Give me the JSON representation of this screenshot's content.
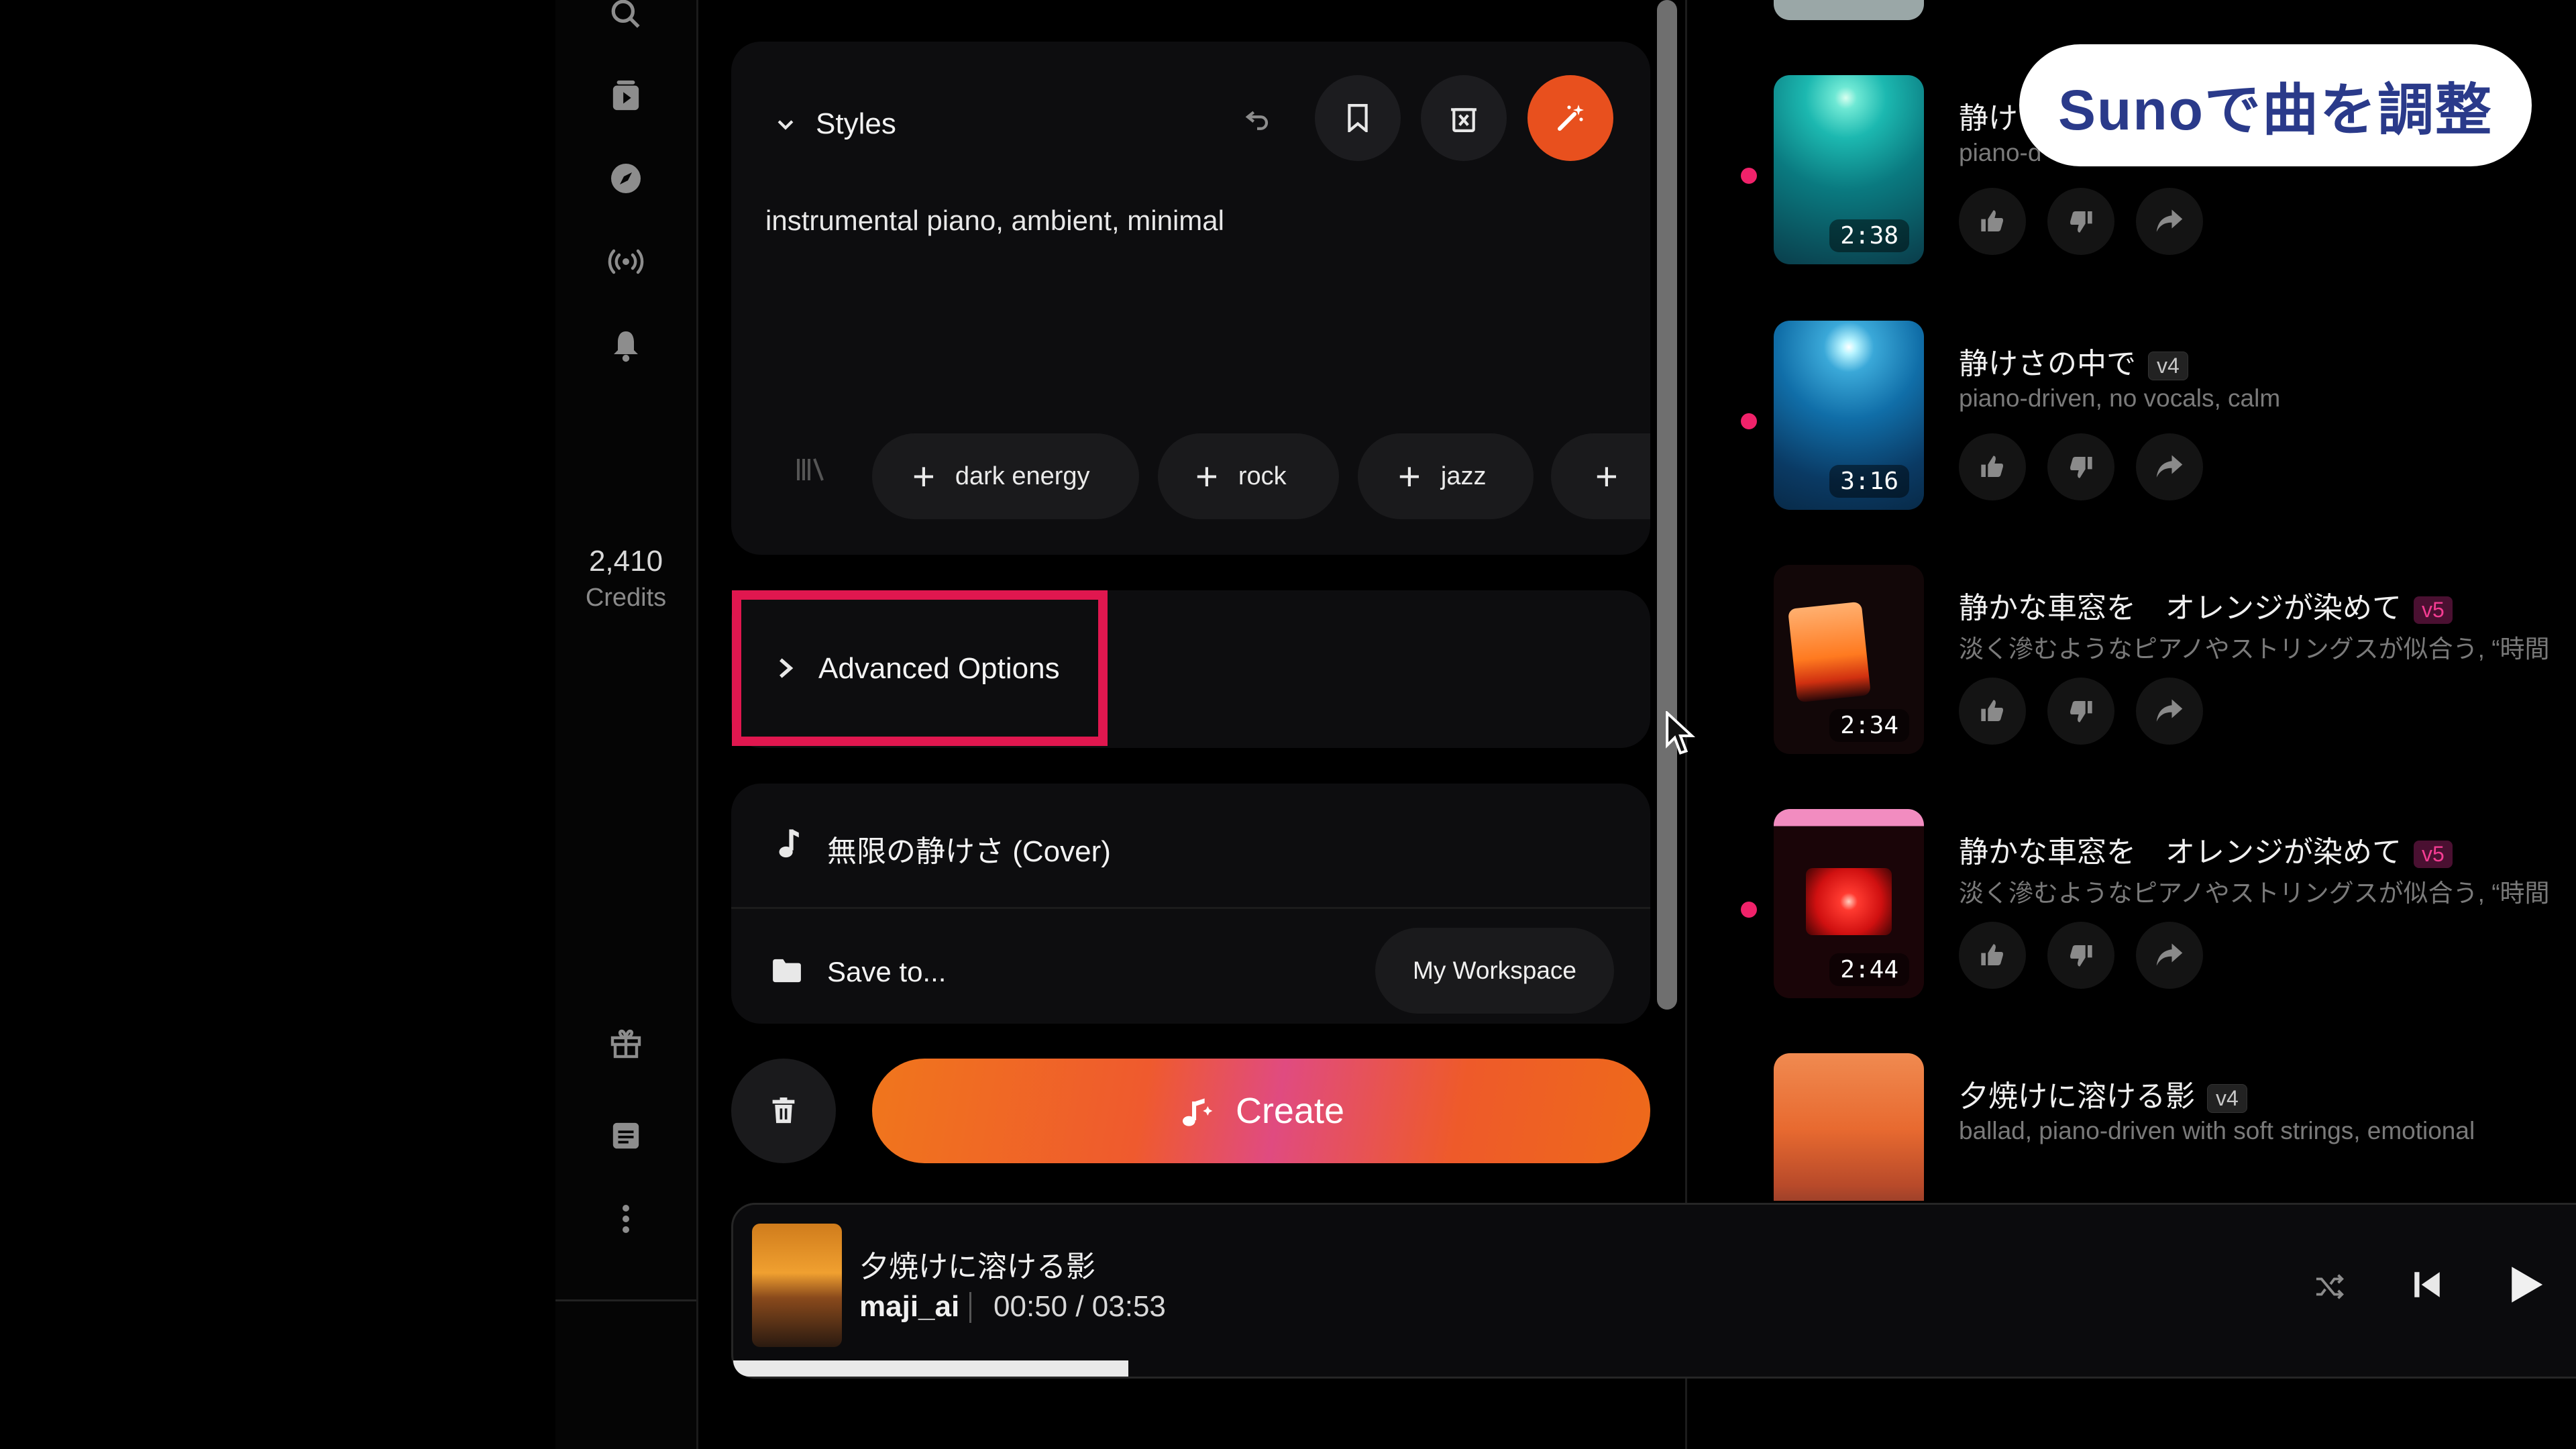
{
  "sidebar": {
    "icons": [
      "search-icon",
      "library-icon",
      "explore-icon",
      "radio-icon",
      "bell-icon",
      "gift-icon",
      "document-icon",
      "more-icon"
    ],
    "credits_value": "2,410",
    "credits_label": "Credits"
  },
  "styles": {
    "header": "Styles",
    "text": "instrumental piano, ambient, minimal",
    "chips": [
      "dark energy",
      "rock",
      "jazz"
    ],
    "magic_color": "#e8501e"
  },
  "advanced_options": {
    "label": "Advanced Options",
    "highlight_color": "#e0174f"
  },
  "song": {
    "title": "無限の静けさ (Cover)",
    "save_label": "Save to...",
    "workspace": "My Workspace"
  },
  "create": {
    "label": "Create"
  },
  "songs": [
    {
      "title": "静け",
      "version": "",
      "desc": "piano-d",
      "duration": "2:38",
      "unread": true
    },
    {
      "title": "静けさの中で",
      "version": "v4",
      "desc": "piano-driven, no vocals, calm",
      "duration": "3:16",
      "unread": true
    },
    {
      "title": "静かな車窓を　オレンジが染めて",
      "version": "v5",
      "desc": "淡く滲むようなピアノやストリングスが似合う, “時間",
      "duration": "2:34",
      "unread": false
    },
    {
      "title": "静かな車窓を　オレンジが染めて",
      "version": "v5",
      "desc": "淡く滲むようなピアノやストリングスが似合う, “時間",
      "duration": "2:44",
      "unread": true
    },
    {
      "title": "夕焼けに溶ける影",
      "version": "v4",
      "desc": "ballad, piano-driven with soft strings, emotional",
      "duration": "",
      "unread": false
    }
  ],
  "overlay_caption": "Sunoで曲を調整",
  "player": {
    "title": "夕焼けに溶ける影",
    "artist": "maji_ai",
    "elapsed": "00:50 /",
    "total": "03:53",
    "progress": 0.214
  }
}
